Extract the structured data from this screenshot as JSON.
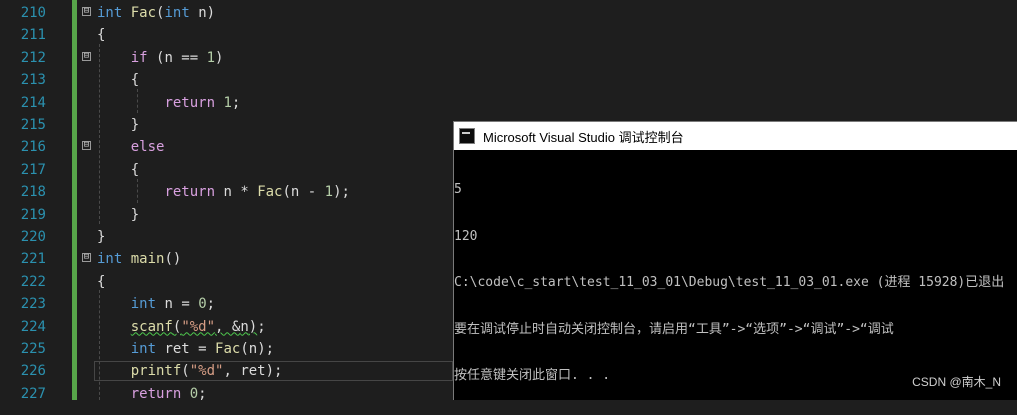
{
  "editor": {
    "line_numbers": [
      "210",
      "211",
      "212",
      "213",
      "214",
      "215",
      "216",
      "217",
      "218",
      "219",
      "220",
      "221",
      "222",
      "223",
      "224",
      "225",
      "226",
      "227"
    ],
    "fold_symbols": [
      "⊟",
      "⊟",
      "⊟"
    ],
    "tokens": {
      "int": "int",
      "fac": "Fac",
      "n": "n",
      "if": "if",
      "one": "1",
      "return": "return",
      "else": "else",
      "main": "main",
      "zero": "0",
      "scanf": "scanf",
      "fmt_d": "\"%d\"",
      "ret": "ret",
      "printf": "printf"
    }
  },
  "console": {
    "title": "Microsoft Visual Studio 调试控制台",
    "lines": [
      "5",
      "120",
      "C:\\code\\c_start\\test_11_03_01\\Debug\\test_11_03_01.exe (进程 15928)已退出",
      "要在调试停止时自动关闭控制台，请启用“工具”->“选项”->“调试”->“调试",
      "按任意键关闭此窗口. . ."
    ]
  },
  "watermark": "CSDN @南木_N",
  "colors": {
    "background": "#1e1e1e",
    "line_number": "#2b91af",
    "keyword": "#569cd6",
    "control": "#d8a0df",
    "function": "#dcdcaa",
    "number": "#b5cea8",
    "string": "#d69d85",
    "change_bar": "#57a64a"
  }
}
